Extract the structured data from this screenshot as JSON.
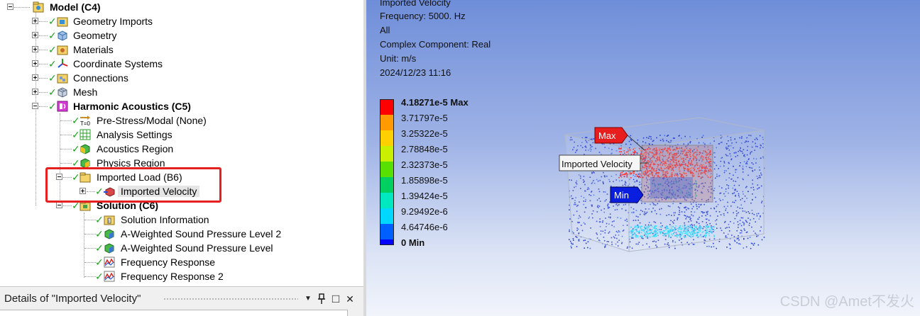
{
  "tree": {
    "root": {
      "label": "Model (C4)"
    },
    "model_children": [
      {
        "label": "Geometry Imports",
        "icon": "geometry-imports-icon"
      },
      {
        "label": "Geometry",
        "icon": "geometry-icon"
      },
      {
        "label": "Materials",
        "icon": "materials-icon"
      },
      {
        "label": "Coordinate Systems",
        "icon": "coordinate-systems-icon"
      },
      {
        "label": "Connections",
        "icon": "connections-icon"
      },
      {
        "label": "Mesh",
        "icon": "mesh-icon"
      }
    ],
    "analysis": {
      "label": "Harmonic Acoustics (C5)"
    },
    "analysis_children": [
      {
        "label": "Pre-Stress/Modal (None)",
        "icon": "prestress-icon"
      },
      {
        "label": "Analysis Settings",
        "icon": "analysis-settings-icon"
      },
      {
        "label": "Acoustics Region",
        "icon": "acoustics-region-icon"
      },
      {
        "label": "Physics Region",
        "icon": "physics-region-icon"
      },
      {
        "label": "Imported Load (B6)",
        "icon": "imported-load-icon"
      }
    ],
    "imported_velocity": {
      "label": "Imported Velocity"
    },
    "solution": {
      "label": "Solution (C6)"
    },
    "solution_children": [
      {
        "label": "Solution Information",
        "icon": "solution-information-icon"
      },
      {
        "label": "A-Weighted Sound Pressure Level 2",
        "icon": "spl-icon"
      },
      {
        "label": "A-Weighted Sound Pressure Level",
        "icon": "spl-icon"
      },
      {
        "label": "Frequency Response",
        "icon": "frequency-response-icon"
      },
      {
        "label": "Frequency Response 2",
        "icon": "frequency-response-icon"
      }
    ]
  },
  "details": {
    "title": "Details of \"Imported Velocity\"",
    "pin_glyph": "📌",
    "dropdown_glyph": "▼",
    "restore_glyph": "□",
    "close_glyph": "✕"
  },
  "viewport": {
    "info": [
      "Imported Velocity",
      "Frequency: 5000. Hz",
      "All",
      "Complex Component: Real",
      "Unit: m/s",
      "2024/12/23 11:16"
    ],
    "legend": {
      "labels": [
        "4.18271e-5 Max",
        "3.71797e-5",
        "3.25322e-5",
        "2.78848e-5",
        "2.32373e-5",
        "1.85898e-5",
        "1.39424e-5",
        "9.29492e-6",
        "4.64746e-6",
        "0 Min"
      ],
      "colors": [
        "#ff0000",
        "#ff9a00",
        "#ffd000",
        "#c8f000",
        "#58e000",
        "#00d060",
        "#00e8c0",
        "#00d8ff",
        "#0060ff",
        "#0000ff"
      ]
    },
    "max_tag": "Max",
    "min_tag": "Min",
    "probe_label": "Imported Velocity",
    "watermark": "CSDN @Amet不发火"
  },
  "colors": {
    "check": "#1aa31a",
    "highlight": "#e61f1f",
    "max_tag": "#e81e1e",
    "min_tag": "#0a1ee0"
  }
}
